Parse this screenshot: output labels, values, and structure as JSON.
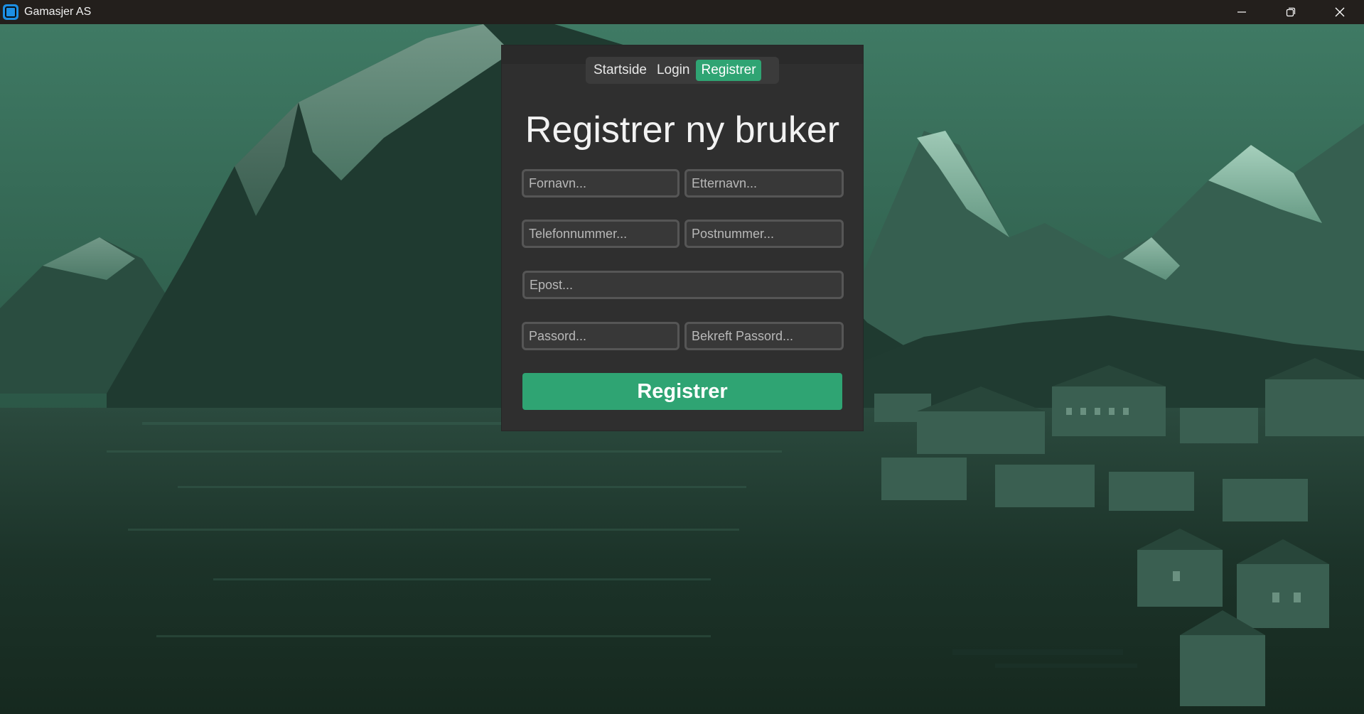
{
  "window": {
    "title": "Gamasjer AS",
    "controls": {
      "minimize_icon": "minimize-icon",
      "maximize_icon": "restore-icon",
      "close_icon": "close-icon"
    }
  },
  "nav": {
    "items": [
      {
        "label": "Startside",
        "active": false
      },
      {
        "label": "Login",
        "active": false
      },
      {
        "label": "Registrer",
        "active": true
      }
    ]
  },
  "form": {
    "heading": "Registrer ny bruker",
    "fields": {
      "first_name": {
        "placeholder": "Fornavn...",
        "value": ""
      },
      "last_name": {
        "placeholder": "Etternavn...",
        "value": ""
      },
      "phone": {
        "placeholder": "Telefonnummer...",
        "value": ""
      },
      "postal_code": {
        "placeholder": "Postnummer...",
        "value": ""
      },
      "email": {
        "placeholder": "Epost...",
        "value": ""
      },
      "password": {
        "placeholder": "Passord...",
        "value": ""
      },
      "confirm_password": {
        "placeholder": "Bekreft Passord...",
        "value": ""
      }
    },
    "submit_label": "Registrer"
  },
  "colors": {
    "accent": "#2fa473",
    "panel": "#2f2f2f",
    "titlebar": "#231f1c",
    "background_tint": "#1f3a30"
  }
}
